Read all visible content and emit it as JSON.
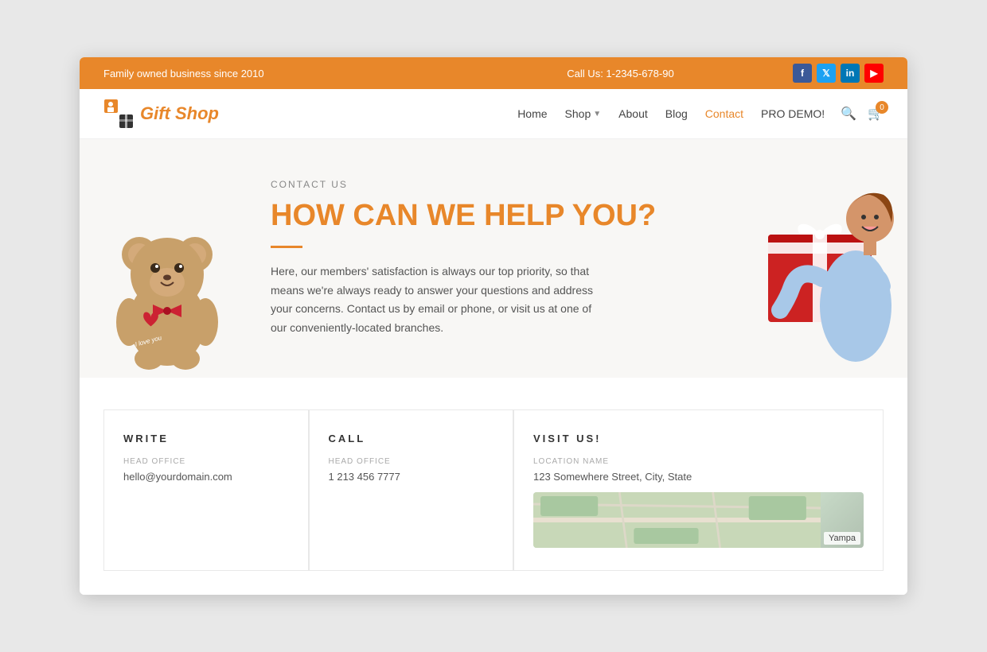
{
  "topbar": {
    "left": "Family owned business since 2010",
    "center": "Call Us: 1-2345-678-90",
    "socials": [
      {
        "name": "facebook",
        "label": "f",
        "class": "social-fb"
      },
      {
        "name": "twitter",
        "label": "t",
        "class": "social-tw"
      },
      {
        "name": "linkedin",
        "label": "in",
        "class": "social-li"
      },
      {
        "name": "youtube",
        "label": "▶",
        "class": "social-yt"
      }
    ]
  },
  "header": {
    "logo_text_plain": "Gift",
    "logo_text_styled": " Shop",
    "nav": [
      {
        "label": "Home",
        "active": false,
        "has_dropdown": false
      },
      {
        "label": "Shop",
        "active": false,
        "has_dropdown": true
      },
      {
        "label": "About",
        "active": false,
        "has_dropdown": false
      },
      {
        "label": "Blog",
        "active": false,
        "has_dropdown": false
      },
      {
        "label": "Contact",
        "active": true,
        "has_dropdown": false
      },
      {
        "label": "PRO DEMO!",
        "active": false,
        "has_dropdown": false
      }
    ],
    "cart_count": "0"
  },
  "hero": {
    "contact_us_label": "CONTACT US",
    "title": "HOW CAN WE HELP YOU?",
    "description": "Here, our members' satisfaction is always our top priority, so that means we're always ready to answer your questions and address your concerns. Contact us by email or phone, or visit us at one of our conveniently-located branches."
  },
  "contact_section": {
    "write": {
      "title": "WRITE",
      "head_office_label": "HEAD OFFICE",
      "email": "hello@yourdomain.com"
    },
    "call": {
      "title": "CALL",
      "head_office_label": "HEAD OFFICE",
      "phone": "1 213 456 7777"
    },
    "visit": {
      "title": "VISIT US!",
      "location_label": "LOCATION NAME",
      "address": "123 Somewhere Street, City, State",
      "map_label": "Yampa"
    }
  }
}
